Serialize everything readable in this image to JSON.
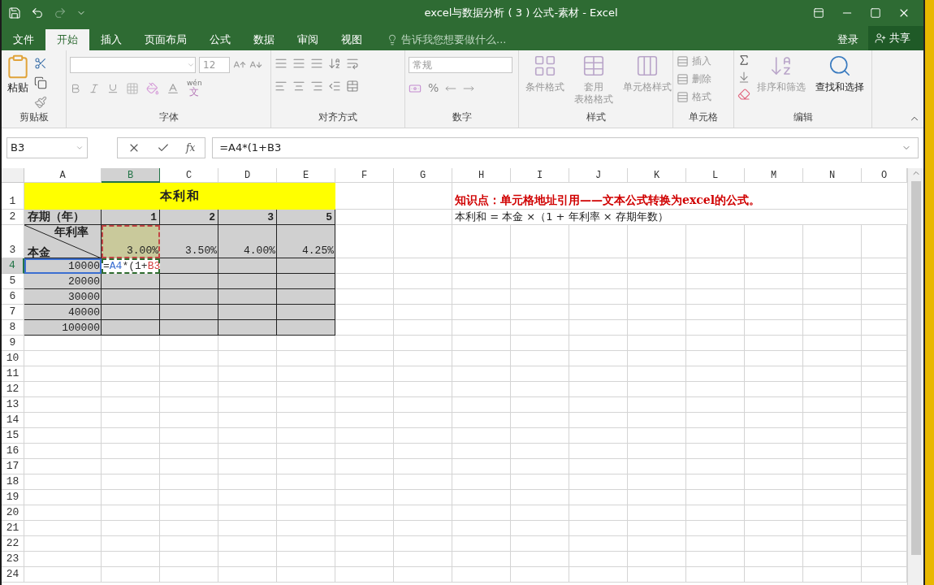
{
  "window": {
    "title": "excel与数据分析 ( 3 ) 公式-素材 - Excel"
  },
  "tabs": [
    {
      "label": "文件",
      "selected": false
    },
    {
      "label": "开始",
      "selected": true
    },
    {
      "label": "插入",
      "selected": false
    },
    {
      "label": "页面布局",
      "selected": false
    },
    {
      "label": "公式",
      "selected": false
    },
    {
      "label": "数据",
      "selected": false
    },
    {
      "label": "审阅",
      "selected": false
    },
    {
      "label": "视图",
      "selected": false
    }
  ],
  "tell_me": {
    "placeholder": "告诉我您想要做什么..."
  },
  "account": {
    "sign_in": "登录",
    "share": "共享"
  },
  "ribbon": {
    "clipboard": {
      "name": "剪贴板",
      "paste": {
        "label": "粘贴",
        "disabled": false
      }
    },
    "font": {
      "name": "字体",
      "size": "12",
      "phonetic_top": "wén",
      "phonetic_bottom": "文"
    },
    "alignment": {
      "name": "对齐方式"
    },
    "number": {
      "name": "数字",
      "format": "常规",
      "percent": "%"
    },
    "styles": {
      "name": "样式",
      "buttons": [
        {
          "lines": [
            "条件格式"
          ],
          "disabled": true
        },
        {
          "lines": [
            "套用",
            "表格格式"
          ],
          "disabled": true
        },
        {
          "lines": [
            "单元格样式"
          ],
          "disabled": true
        }
      ]
    },
    "cells": {
      "name": "单元格",
      "buttons": [
        {
          "label": "插入",
          "disabled": true
        },
        {
          "label": "删除",
          "disabled": true
        },
        {
          "label": "格式",
          "disabled": true
        }
      ]
    },
    "editing": {
      "name": "编辑",
      "buttons": [
        {
          "lines": [
            "排序和筛选"
          ],
          "disabled": true
        },
        {
          "lines": [
            "查找和选择"
          ],
          "disabled": false
        }
      ]
    }
  },
  "formula_bar": {
    "name_box": "B3",
    "function_label": "fx",
    "formula": "=A4*(1+B3"
  },
  "sheet": {
    "columns": [
      {
        "label": "A",
        "selected": false
      },
      {
        "label": "B",
        "selected": true
      },
      {
        "label": "C",
        "selected": false
      },
      {
        "label": "D",
        "selected": false
      },
      {
        "label": "E",
        "selected": false
      },
      {
        "label": "F",
        "selected": false
      },
      {
        "label": "G",
        "selected": false
      },
      {
        "label": "H",
        "selected": false
      },
      {
        "label": "I",
        "selected": false
      },
      {
        "label": "J",
        "selected": false
      },
      {
        "label": "K",
        "selected": false
      },
      {
        "label": "L",
        "selected": false
      },
      {
        "label": "M",
        "selected": false
      },
      {
        "label": "N",
        "selected": false
      },
      {
        "label": "O",
        "selected": false
      }
    ],
    "rows": [
      {
        "number": "1",
        "selected": false,
        "cells": [
          {
            "kind": "title",
            "text": "本利和"
          }
        ],
        "note": {
          "text": "知识点：单元格地址引用——文本公式转换为excel的公式。",
          "kind": "heading"
        }
      },
      {
        "number": "2",
        "selected": false,
        "cells": [
          {
            "kind": "label",
            "text": "存期（年）"
          },
          {
            "kind": "number",
            "text": "1"
          },
          {
            "kind": "number",
            "text": "2"
          },
          {
            "kind": "number",
            "text": "3"
          },
          {
            "kind": "number",
            "text": "5"
          }
        ],
        "note": {
          "text": "本利和 = 本金 ×（1 + 年利率 × 存期年数）",
          "kind": "plain"
        }
      },
      {
        "number": "3",
        "selected": false,
        "cells": [
          {
            "kind": "diagonal",
            "top": "年利率",
            "bottom": "本金"
          },
          {
            "kind": "value",
            "text": "3.00%",
            "marked": true
          },
          {
            "kind": "value",
            "text": "3.50%",
            "marked": false
          },
          {
            "kind": "value",
            "text": "4.00%",
            "marked": false
          },
          {
            "kind": "value",
            "text": "4.25%",
            "marked": false
          }
        ]
      },
      {
        "number": "4",
        "selected": true,
        "cells": [
          {
            "kind": "value",
            "text": "10000",
            "referenced": true
          },
          {
            "kind": "formula",
            "parts": [
              {
                "text": "=",
                "color": "#333333"
              },
              {
                "text": "A4",
                "color": "#3b6fd1"
              },
              {
                "text": "*(1+",
                "color": "#333333"
              },
              {
                "text": "B3",
                "color": "#d23b3b"
              }
            ]
          },
          {
            "kind": "empty"
          },
          {
            "kind": "empty"
          },
          {
            "kind": "empty"
          }
        ]
      },
      {
        "number": "5",
        "selected": false,
        "cells": [
          {
            "kind": "value",
            "text": "20000"
          },
          {
            "kind": "empty"
          },
          {
            "kind": "empty"
          },
          {
            "kind": "empty"
          },
          {
            "kind": "empty"
          }
        ]
      },
      {
        "number": "6",
        "selected": false,
        "cells": [
          {
            "kind": "value",
            "text": "30000"
          },
          {
            "kind": "empty"
          },
          {
            "kind": "empty"
          },
          {
            "kind": "empty"
          },
          {
            "kind": "empty"
          }
        ]
      },
      {
        "number": "7",
        "selected": false,
        "cells": [
          {
            "kind": "value",
            "text": "40000"
          },
          {
            "kind": "empty"
          },
          {
            "kind": "empty"
          },
          {
            "kind": "empty"
          },
          {
            "kind": "empty"
          }
        ]
      },
      {
        "number": "8",
        "selected": false,
        "cells": [
          {
            "kind": "value",
            "text": "100000"
          },
          {
            "kind": "empty"
          },
          {
            "kind": "empty"
          },
          {
            "kind": "empty"
          },
          {
            "kind": "empty"
          }
        ]
      },
      {
        "number": "9",
        "selected": false
      },
      {
        "number": "10",
        "selected": false
      },
      {
        "number": "11",
        "selected": false
      },
      {
        "number": "12",
        "selected": false
      },
      {
        "number": "13",
        "selected": false
      },
      {
        "number": "14",
        "selected": false
      },
      {
        "number": "15",
        "selected": false
      },
      {
        "number": "16",
        "selected": false
      },
      {
        "number": "17",
        "selected": false
      },
      {
        "number": "18",
        "selected": false
      },
      {
        "number": "19",
        "selected": false
      },
      {
        "number": "20",
        "selected": false
      },
      {
        "number": "21",
        "selected": false
      },
      {
        "number": "22",
        "selected": false
      },
      {
        "number": "23",
        "selected": false
      },
      {
        "number": "24",
        "selected": false
      }
    ]
  }
}
